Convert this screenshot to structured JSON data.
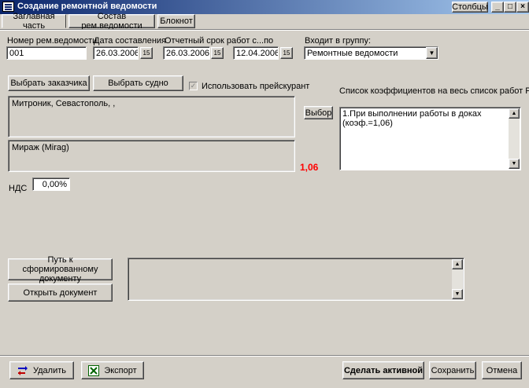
{
  "window": {
    "title": "Создание ремонтной ведомости",
    "columns_button": "Столбцы",
    "minimize": "_",
    "maximize": "□",
    "close": "×"
  },
  "tabs": [
    {
      "label": "Заглавная часть",
      "active": true
    },
    {
      "label": "Состав рем.ведомости",
      "active": false
    },
    {
      "label": "Блокнот",
      "active": false
    }
  ],
  "form": {
    "number_label": "Номер рем.ведомости",
    "number_value": "001",
    "date_label": "Дата составления",
    "date_value": "26.03.2006",
    "period_label": "Отчетный срок работ с...по",
    "period_from": "26.03.2006",
    "period_to": "12.04.2006",
    "calendar_glyph": "15",
    "group_label": "Входит в группу:",
    "group_value": "Ремонтные ведомости",
    "select_customer": "Выбрать заказчика",
    "select_vessel": "Выбрать судно",
    "use_pricelist_label": "Использовать прейскурант",
    "use_pricelist_checked": true,
    "customer_text": "Митроник, Севастополь, ,",
    "vessel_text": "Мираж (Mirag)",
    "coef_value": "1,06",
    "vat_label": "НДС",
    "vat_value": "0,00%",
    "coef_list_label": "Список коэффициентов на весь список работ РВ",
    "choose_button": "Выбор",
    "coef_items": [
      "1.При выполнении работы в доках  (коэф.=1,06)"
    ],
    "doc_path_button": "Путь к сформированному документу",
    "open_doc_button": "Открыть документ",
    "doc_path_value": ""
  },
  "footer": {
    "delete": "Удалить",
    "export": "Экспорт",
    "make_active": "Сделать активной",
    "save": "Сохранить",
    "cancel": "Отмена"
  },
  "colors": {
    "title_start": "#0a246a",
    "title_end": "#a6caf0",
    "accent_red": "#ff0000",
    "face": "#d4d0c8"
  }
}
